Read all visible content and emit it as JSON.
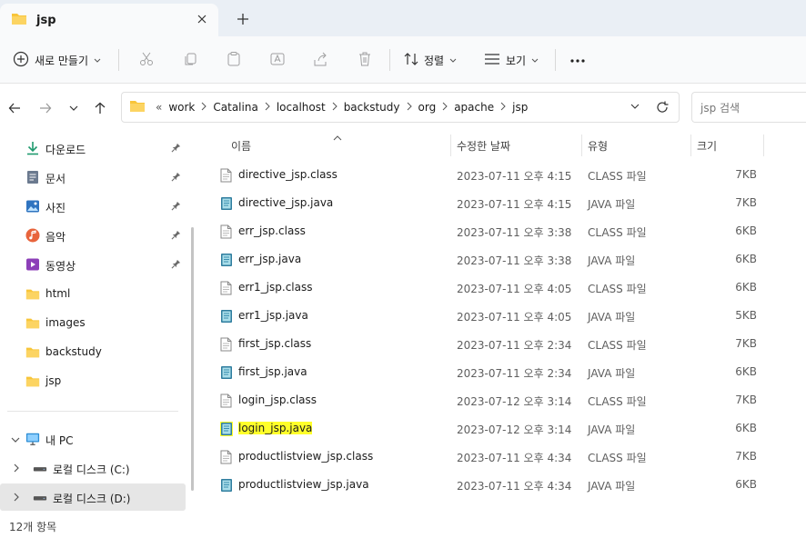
{
  "window": {
    "tab_title": "jsp",
    "new_tab_symbol": "+"
  },
  "toolbar": {
    "new_label": "새로 만들기",
    "sort_label": "정렬",
    "view_label": "보기",
    "more_symbol": "•••"
  },
  "address": {
    "overflow_symbol": "«",
    "crumbs": [
      "work",
      "Catalina",
      "localhost",
      "backstudy",
      "org",
      "apache",
      "jsp"
    ],
    "search_placeholder": "jsp 검색"
  },
  "sidebar": {
    "quick_access": [
      {
        "label": "다운로드",
        "icon": "download-icon",
        "pinned": true
      },
      {
        "label": "문서",
        "icon": "document-icon",
        "pinned": true
      },
      {
        "label": "사진",
        "icon": "picture-icon",
        "pinned": true
      },
      {
        "label": "음악",
        "icon": "music-icon",
        "pinned": true
      },
      {
        "label": "동영상",
        "icon": "video-icon",
        "pinned": true
      },
      {
        "label": "html",
        "icon": "folder-icon",
        "pinned": false
      },
      {
        "label": "images",
        "icon": "folder-icon",
        "pinned": false
      },
      {
        "label": "backstudy",
        "icon": "folder-icon",
        "pinned": false
      },
      {
        "label": "jsp",
        "icon": "folder-icon",
        "pinned": false
      }
    ],
    "this_pc": "내 PC",
    "drives": [
      {
        "label": "로컬 디스크 (C:)",
        "icon": "drive-icon",
        "selected": false
      },
      {
        "label": "로컬 디스크 (D:)",
        "icon": "drive-icon",
        "selected": true
      }
    ]
  },
  "columns": {
    "name": "이름",
    "date": "수정한 날짜",
    "type": "유형",
    "size": "크기"
  },
  "files": [
    {
      "name": "directive_jsp.class",
      "date": "2023-07-11 오후 4:15",
      "type": "CLASS 파일",
      "size": "7KB",
      "kind": "class",
      "highlight": false
    },
    {
      "name": "directive_jsp.java",
      "date": "2023-07-11 오후 4:15",
      "type": "JAVA 파일",
      "size": "7KB",
      "kind": "java",
      "highlight": false
    },
    {
      "name": "err_jsp.class",
      "date": "2023-07-11 오후 3:38",
      "type": "CLASS 파일",
      "size": "6KB",
      "kind": "class",
      "highlight": false
    },
    {
      "name": "err_jsp.java",
      "date": "2023-07-11 오후 3:38",
      "type": "JAVA 파일",
      "size": "6KB",
      "kind": "java",
      "highlight": false
    },
    {
      "name": "err1_jsp.class",
      "date": "2023-07-11 오후 4:05",
      "type": "CLASS 파일",
      "size": "6KB",
      "kind": "class",
      "highlight": false
    },
    {
      "name": "err1_jsp.java",
      "date": "2023-07-11 오후 4:05",
      "type": "JAVA 파일",
      "size": "5KB",
      "kind": "java",
      "highlight": false
    },
    {
      "name": "first_jsp.class",
      "date": "2023-07-11 오후 2:34",
      "type": "CLASS 파일",
      "size": "7KB",
      "kind": "class",
      "highlight": false
    },
    {
      "name": "first_jsp.java",
      "date": "2023-07-11 오후 2:34",
      "type": "JAVA 파일",
      "size": "6KB",
      "kind": "java",
      "highlight": false
    },
    {
      "name": "login_jsp.class",
      "date": "2023-07-12 오후 3:14",
      "type": "CLASS 파일",
      "size": "7KB",
      "kind": "class",
      "highlight": false
    },
    {
      "name": "login_jsp.java",
      "date": "2023-07-12 오후 3:14",
      "type": "JAVA 파일",
      "size": "6KB",
      "kind": "java",
      "highlight": true
    },
    {
      "name": "productlistview_jsp.class",
      "date": "2023-07-11 오후 4:34",
      "type": "CLASS 파일",
      "size": "7KB",
      "kind": "class",
      "highlight": false
    },
    {
      "name": "productlistview_jsp.java",
      "date": "2023-07-11 오후 4:34",
      "type": "JAVA 파일",
      "size": "6KB",
      "kind": "java",
      "highlight": false
    }
  ],
  "status": {
    "item_count": "12개 항목"
  },
  "colors": {
    "folder": "#f8c53a",
    "highlight": "#ffff2a",
    "selected_bg": "#e6e6e6",
    "tabbar_bg": "#eaeff5"
  }
}
